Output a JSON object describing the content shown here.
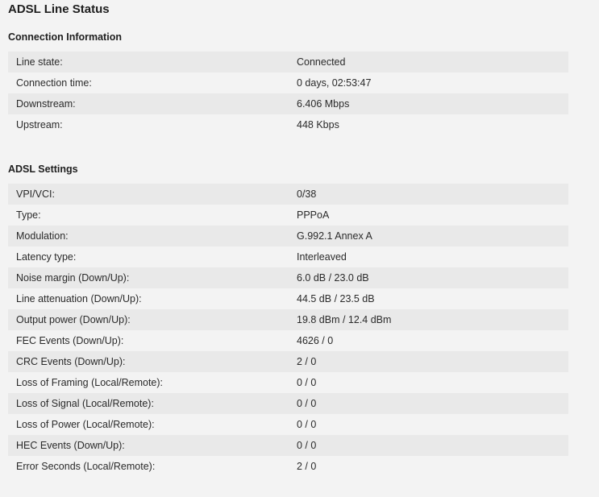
{
  "page": {
    "title": "ADSL Line Status"
  },
  "connection_information": {
    "heading": "Connection Information",
    "rows": [
      {
        "label": "Line state:",
        "value": "Connected"
      },
      {
        "label": "Connection time:",
        "value": "0 days, 02:53:47"
      },
      {
        "label": "Downstream:",
        "value": "6.406 Mbps"
      },
      {
        "label": "Upstream:",
        "value": "448 Kbps"
      }
    ]
  },
  "adsl_settings": {
    "heading": "ADSL Settings",
    "rows": [
      {
        "label": "VPI/VCI:",
        "value": "0/38"
      },
      {
        "label": "Type:",
        "value": "PPPoA"
      },
      {
        "label": "Modulation:",
        "value": "G.992.1 Annex A"
      },
      {
        "label": "Latency type:",
        "value": "Interleaved"
      },
      {
        "label": "Noise margin (Down/Up):",
        "value": "6.0 dB / 23.0 dB"
      },
      {
        "label": "Line attenuation (Down/Up):",
        "value": "44.5 dB / 23.5 dB"
      },
      {
        "label": "Output power (Down/Up):",
        "value": "19.8 dBm / 12.4 dBm"
      },
      {
        "label": "FEC Events (Down/Up):",
        "value": "4626 / 0"
      },
      {
        "label": "CRC Events (Down/Up):",
        "value": "2 / 0"
      },
      {
        "label": "Loss of Framing (Local/Remote):",
        "value": "0 / 0"
      },
      {
        "label": "Loss of Signal (Local/Remote):",
        "value": "0 / 0"
      },
      {
        "label": "Loss of Power (Local/Remote):",
        "value": "0 / 0"
      },
      {
        "label": "HEC Events (Down/Up):",
        "value": "0 / 0"
      },
      {
        "label": "Error Seconds (Local/Remote):",
        "value": "2 / 0"
      }
    ]
  }
}
